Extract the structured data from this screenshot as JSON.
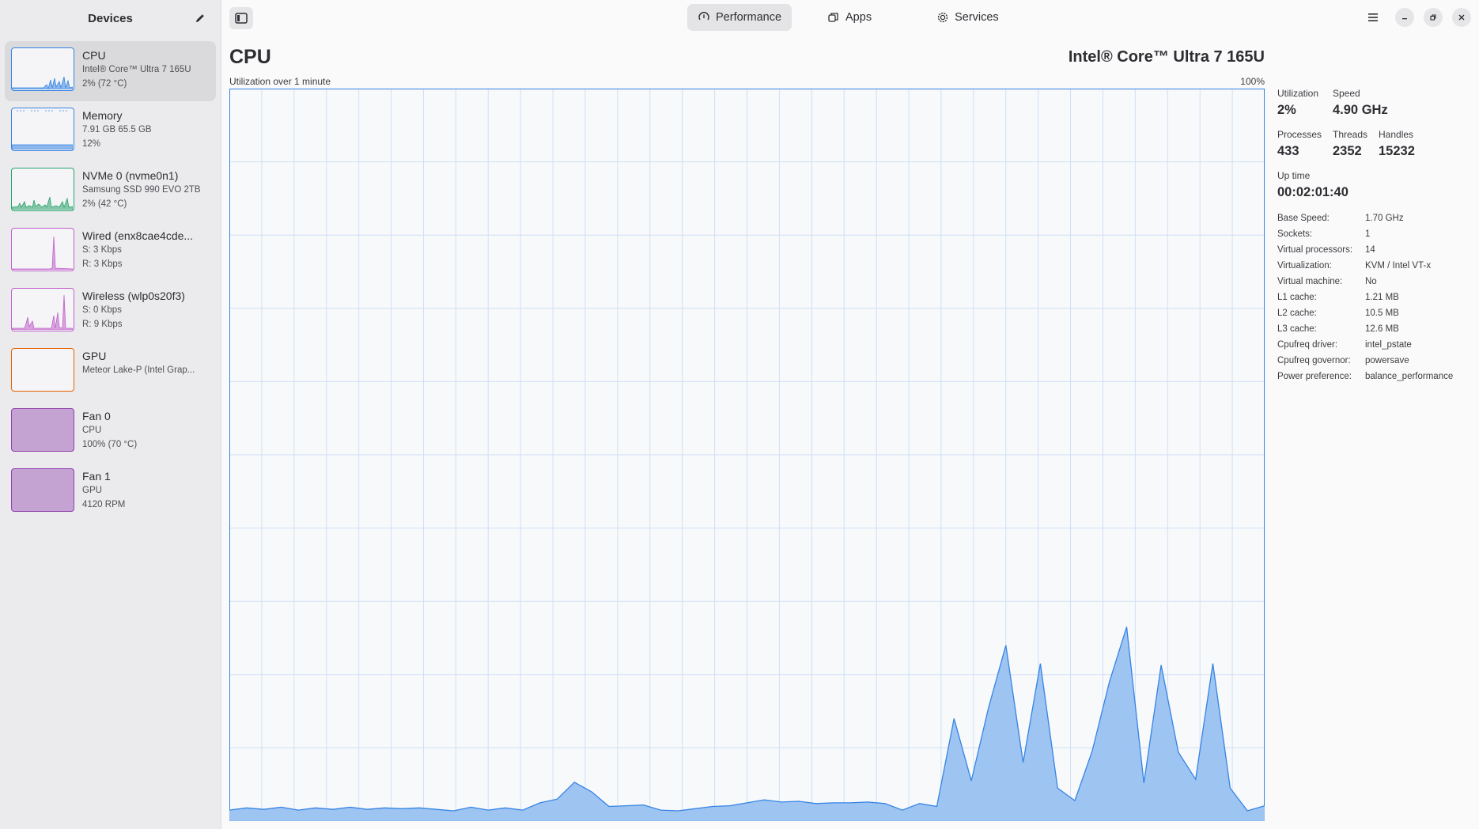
{
  "sidebar": {
    "title": "Devices",
    "devices": [
      {
        "name": "CPU",
        "line1": "Intel® Core™ Ultra 7 165U",
        "line2": "2% (72 °C)",
        "color": "#3584e4",
        "selected": true
      },
      {
        "name": "Memory",
        "line1": "7.91 GB 65.5 GB",
        "line2": "12%",
        "color": "#3584e4"
      },
      {
        "name": "NVMe 0 (nvme0n1)",
        "line1": "Samsung SSD 990 EVO 2TB",
        "line2": "2% (42 °C)",
        "color": "#26a269"
      },
      {
        "name": "Wired (enx8cae4cde...",
        "line1": "S: 3 Kbps",
        "line2": "R: 3 Kbps",
        "color": "#c061cb"
      },
      {
        "name": "Wireless (wlp0s20f3)",
        "line1": "S: 0 Kbps",
        "line2": "R: 9 Kbps",
        "color": "#c061cb"
      },
      {
        "name": "GPU",
        "line1": "Meteor Lake-P (Intel Grap...",
        "line2": "",
        "color": "#e66100"
      },
      {
        "name": "Fan 0",
        "line1": "CPU",
        "line2": "100% (70 °C)",
        "color": "#9141ac"
      },
      {
        "name": "Fan 1",
        "line1": "GPU",
        "line2": "4120 RPM",
        "color": "#9141ac"
      }
    ]
  },
  "tabs": [
    {
      "label": "Performance",
      "icon": "gauge-icon",
      "active": true
    },
    {
      "label": "Apps",
      "icon": "apps-icon",
      "active": false
    },
    {
      "label": "Services",
      "icon": "gear-icon",
      "active": false
    }
  ],
  "main": {
    "title": "CPU",
    "model": "Intel® Core™ Ultra 7 165U",
    "graph_caption": "Utilization over 1 minute",
    "graph_max": "100%"
  },
  "stats": {
    "utilization_label": "Utilization",
    "utilization": "2%",
    "speed_label": "Speed",
    "speed": "4.90 GHz",
    "processes_label": "Processes",
    "processes": "433",
    "threads_label": "Threads",
    "threads": "2352",
    "handles_label": "Handles",
    "handles": "15232",
    "uptime_label": "Up time",
    "uptime": "00:02:01:40"
  },
  "properties": [
    {
      "k": "Base Speed:",
      "v": "1.70 GHz"
    },
    {
      "k": "Sockets:",
      "v": "1"
    },
    {
      "k": "Virtual processors:",
      "v": "14"
    },
    {
      "k": "Virtualization:",
      "v": "KVM / Intel VT-x"
    },
    {
      "k": "Virtual machine:",
      "v": "No"
    },
    {
      "k": "L1 cache:",
      "v": "1.21 MB"
    },
    {
      "k": "L2 cache:",
      "v": "10.5 MB"
    },
    {
      "k": "L3 cache:",
      "v": "12.6 MB"
    },
    {
      "k": "Cpufreq driver:",
      "v": "intel_pstate"
    },
    {
      "k": "Cpufreq governor:",
      "v": "powersave"
    },
    {
      "k": "Power preference:",
      "v": "balance_performance"
    }
  ],
  "chart_data": {
    "type": "area",
    "ylim": [
      0,
      100
    ],
    "color": "#3584e4",
    "values": [
      1.5,
      1.8,
      1.6,
      1.9,
      1.5,
      1.8,
      1.6,
      1.9,
      1.6,
      1.8,
      1.7,
      1.8,
      1.6,
      1.4,
      1.9,
      1.5,
      1.8,
      1.5,
      2.5,
      3,
      5.3,
      4,
      2,
      2.1,
      2.2,
      1.5,
      1.4,
      1.7,
      2,
      2.1,
      2.5,
      2.9,
      2.6,
      2.7,
      2.4,
      2.5,
      2.5,
      2.6,
      2.4,
      1.5,
      2.4,
      2,
      14,
      5.5,
      15.5,
      24,
      8,
      21.5,
      4.5,
      2.8,
      9.5,
      19,
      26.5,
      5.2,
      21.3,
      9.4,
      5.7,
      21.5,
      4.5,
      1.4,
      2.1
    ]
  }
}
